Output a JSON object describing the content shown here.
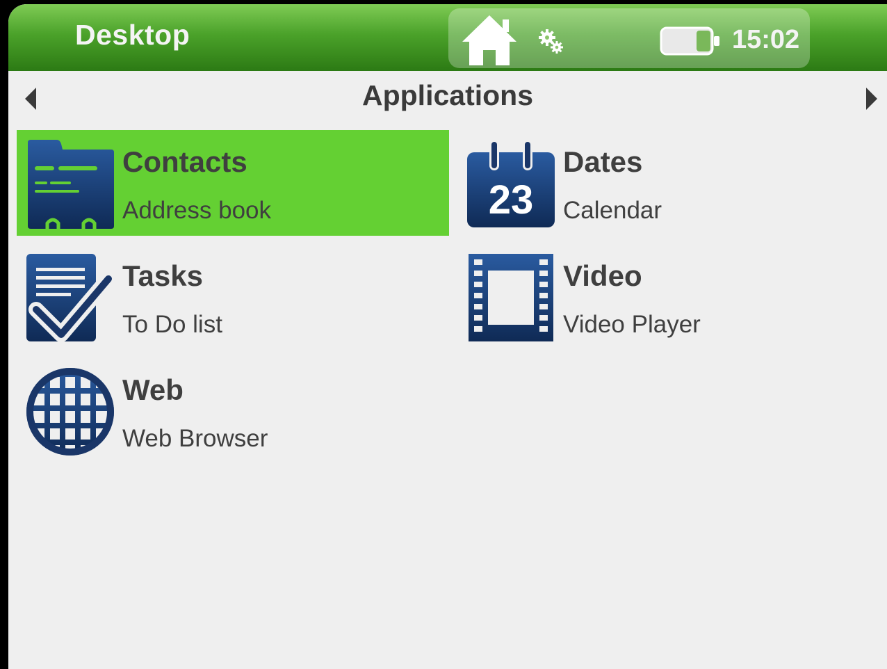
{
  "topbar": {
    "title": "Desktop",
    "home_icon": "home-icon",
    "settings_icon": "gear-icon",
    "battery_icon": "battery-icon",
    "time": "15:02"
  },
  "navigation": {
    "heading": "Applications",
    "prev_icon": "arrow-left-icon",
    "next_icon": "arrow-right-icon"
  },
  "apps": [
    {
      "name": "Contacts",
      "description": "Address book",
      "icon": "contacts-icon",
      "selected": true
    },
    {
      "name": "Dates",
      "description": "Calendar",
      "icon": "calendar-icon",
      "icon_text": "23",
      "selected": false
    },
    {
      "name": "Tasks",
      "description": "To Do list",
      "icon": "tasks-icon",
      "selected": false
    },
    {
      "name": "Video",
      "description": "Video Player",
      "icon": "film-icon",
      "selected": false
    },
    {
      "name": "Web",
      "description": "Web Browser",
      "icon": "globe-icon",
      "selected": false
    }
  ],
  "colors": {
    "topbar_green": "#4ba22a",
    "selection_green": "#64d033",
    "icon_navy": "#1a3668",
    "background": "#efefef"
  }
}
